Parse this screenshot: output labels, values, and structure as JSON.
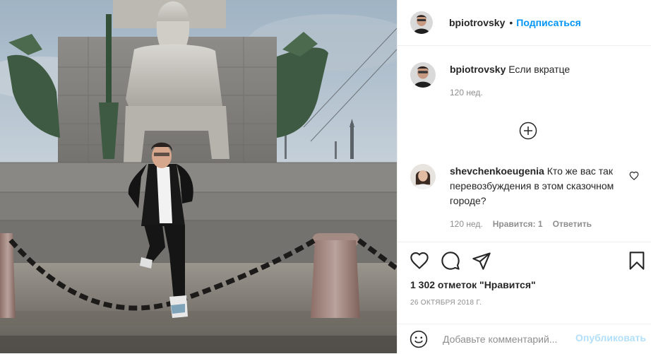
{
  "post": {
    "username": "bpiotrovsky",
    "separator": "•",
    "follow_label": "Подписаться",
    "caption": {
      "username": "bpiotrovsky",
      "text": "Если вкратце",
      "time": "120 нед."
    },
    "load_more_icon": "plus-circle-icon",
    "comments": [
      {
        "username": "shevchenkoeugenia",
        "text": "Кто же вас так перевозбуждения в этом сказочном городе?",
        "time": "120 нед.",
        "likes_label": "Нравится: 1",
        "reply_label": "Ответить"
      }
    ],
    "likes_count": "1 302 отметок \"Нравится\"",
    "date": "26 ОКТЯБРЯ 2018 Г.",
    "comment_placeholder": "Добавьте комментарий...",
    "publish_label": "Опубликовать",
    "colors": {
      "accent": "#0095f6",
      "publish_disabled": "#b2dffc",
      "text": "#262626",
      "secondary": "#8e8e8e",
      "divider": "#efefef"
    }
  }
}
